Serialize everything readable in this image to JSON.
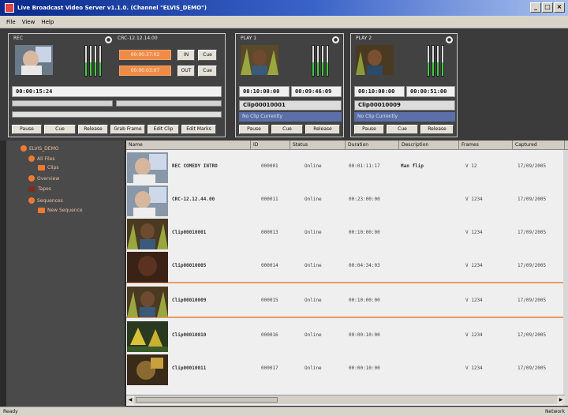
{
  "window": {
    "title": "Live Broadcast Video Server v1.1.0. (Channel \"ELVIS_DEMO\")",
    "buttons": {
      "minimize": "_",
      "maximize": "□",
      "close": "×"
    }
  },
  "menu": [
    "File",
    "View",
    "Help"
  ],
  "record_panel": {
    "label": "REC",
    "clip_label": "CRC-12.12.14.00",
    "timecode": "00:00:15:24",
    "orange_btn_1": "00:00:37:02",
    "orange_btn_2": "00:00:03:07",
    "in_label": "IN",
    "out_label": "OUT",
    "cue_label_1": "Cue",
    "cue_label_2": "Cue",
    "buttons": [
      "Pause",
      "Cue",
      "Release",
      "Grab Frame",
      "Edit Clip",
      "Edit Marks"
    ]
  },
  "players": [
    {
      "label": "PLAY 1",
      "tc_current": "00:10:00:00",
      "tc_remaining": "00:09:46:09",
      "clip": "Clip00010001",
      "status": "No Clip Currently",
      "buttons": [
        "Pause",
        "Cue",
        "Release"
      ]
    },
    {
      "label": "PLAY 2",
      "tc_current": "00:10:00:00",
      "tc_remaining": "00:00:51:00",
      "clip": "Clip00010009",
      "status": "No Clip Currently",
      "buttons": [
        "Pause",
        "Cue",
        "Release"
      ]
    }
  ],
  "tree": {
    "root": "ELVIS_DEMO",
    "items": [
      "All Files",
      "Clips",
      "Overview",
      "Tapes",
      "Sequences",
      "New Sequence"
    ]
  },
  "table": {
    "columns": [
      "Name",
      "ID",
      "Status",
      "Duration",
      "Description",
      "Frames",
      "Captured"
    ],
    "rows": [
      {
        "name": "REC COMEDY INTRO",
        "id": "000001",
        "status": "Online",
        "duration": "00:01:11:17",
        "description": "Man flip",
        "frames": "V 12",
        "captured": "17/09/2005"
      },
      {
        "name": "CRC-12.12.44.00",
        "id": "000011",
        "status": "Online",
        "duration": "00:23:00:00",
        "description": "",
        "frames": "V 1234",
        "captured": "17/09/2005"
      },
      {
        "name": "Clip00010001",
        "id": "000013",
        "status": "Online",
        "duration": "00:10:00:00",
        "description": "",
        "frames": "V 1234",
        "captured": "17/09/2005"
      },
      {
        "name": "Clip00010005",
        "id": "000014",
        "status": "Online",
        "duration": "00:04:34:03",
        "description": "",
        "frames": "V 1234",
        "captured": "17/09/2005"
      },
      {
        "name": "Clip00010009",
        "id": "000015",
        "status": "Online",
        "duration": "00:10:00:00",
        "description": "",
        "frames": "V 1234",
        "captured": "17/09/2005"
      },
      {
        "name": "Clip00010010",
        "id": "000016",
        "status": "Online",
        "duration": "00:00:10:00",
        "description": "",
        "frames": "V 1234",
        "captured": "17/09/2005"
      },
      {
        "name": "Clip00010011",
        "id": "000017",
        "status": "Online",
        "duration": "00:00:10:00",
        "description": "",
        "frames": "V 1234",
        "captured": "17/09/2005"
      }
    ]
  },
  "statusbar": {
    "left": "Ready",
    "right": "Network"
  }
}
